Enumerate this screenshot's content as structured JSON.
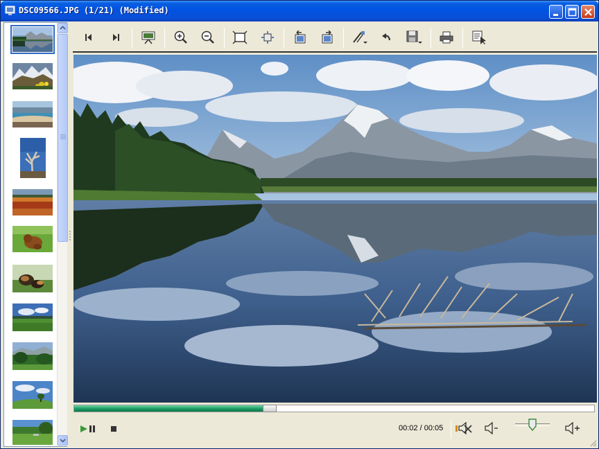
{
  "window": {
    "title": "DSC09566.JPG (1/21) (Modified)",
    "accent": "#0054e3",
    "controls": [
      "minimize-icon",
      "maximize-icon",
      "close-icon"
    ]
  },
  "thumbnails": [
    {
      "name": "mountain-lake-reflection",
      "selected": true
    },
    {
      "name": "snowy-peaks-flowers",
      "selected": false
    },
    {
      "name": "coastal-lagoon",
      "selected": false
    },
    {
      "name": "dead-tree-portrait",
      "selected": false
    },
    {
      "name": "hot-spring-terrain",
      "selected": false
    },
    {
      "name": "dog-on-grass",
      "selected": false
    },
    {
      "name": "two-dogs-meadow",
      "selected": false
    },
    {
      "name": "green-field-sky",
      "selected": false
    },
    {
      "name": "forest-valley",
      "selected": false
    },
    {
      "name": "lone-tree-hill",
      "selected": false
    },
    {
      "name": "park-lawn",
      "selected": false
    }
  ],
  "toolbar": {
    "items": [
      "previous-icon",
      "next-icon",
      "slideshow-icon",
      "zoom-in-icon",
      "zoom-out-icon",
      "fit-to-window-icon",
      "actual-size-icon",
      "rotate-left-icon",
      "rotate-right-icon",
      "edit-icon",
      "undo-icon",
      "save-icon",
      "print-icon",
      "select-icon"
    ]
  },
  "playback": {
    "progress": 0.4,
    "time_text": "00:02 / 00:05",
    "volume": 0.5,
    "play_pause_icon": "play-pause-icon",
    "stop_icon": "stop-icon",
    "mute_icon": "mute-icon",
    "volume_down_icon": "volume-down-icon",
    "volume_up_icon": "volume-up-icon"
  }
}
